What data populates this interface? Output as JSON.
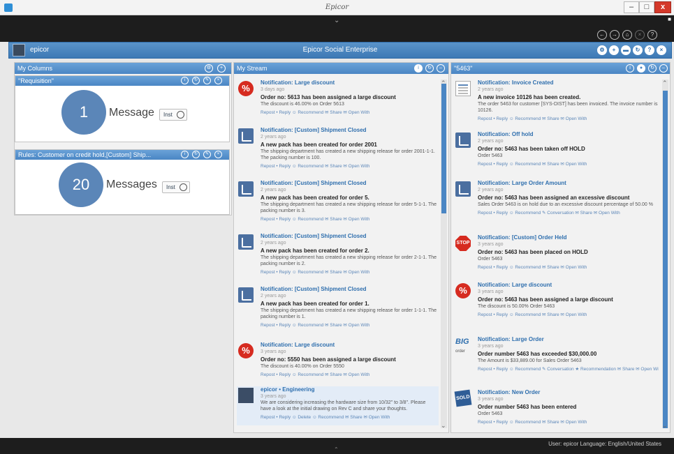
{
  "window": {
    "title": "Epicor",
    "min": "–",
    "max": "□",
    "close": "x",
    "chevron": "⌄"
  },
  "nav_buttons": [
    "←",
    "→",
    "⌂",
    "×",
    "?"
  ],
  "header": {
    "user": "epicor",
    "title": "Epicor Social Enterprise",
    "icons": [
      "gear-icon",
      "plus-icon",
      "chat-icon",
      "refresh-icon",
      "help-icon",
      "close-icon"
    ]
  },
  "left": {
    "title": "My Columns",
    "cards": [
      {
        "title": "\"Requisition\"",
        "count": "1",
        "label": "Message",
        "install": "Inst"
      },
      {
        "title": "Rules: Customer on credit hold,[Custom] Ship...",
        "count": "20",
        "label": "Messages",
        "install": "Inst"
      }
    ]
  },
  "stream": {
    "title": "My Stream",
    "items": [
      {
        "icon": "discount",
        "title": "Notification: Large discount",
        "time": "3 days ago",
        "headline": "Order no: 5613 has been assigned a large discount",
        "desc": "The discount is 46.00% on Order 5613",
        "actions": "Repost • Reply ☺ Recommend ✉ Share ✉ Open With"
      },
      {
        "icon": "rss",
        "title": "Notification: [Custom] Shipment Closed",
        "time": "2 years ago",
        "headline": "A new pack has been created for order 2001",
        "desc": "The shipping department has created a new shipping release for order 2001-1-1. The packing number is 100.",
        "actions": "Repost • Reply ☺ Recommend ✉ Share ✉ Open With"
      },
      {
        "icon": "rss",
        "title": "Notification: [Custom] Shipment Closed",
        "time": "2 years ago",
        "headline": "A new pack has been created for order 5.",
        "desc": "The shipping department has created a new shipping release for order 5-1-1. The packing number is 3.",
        "actions": "Repost • Reply ☺ Recommend ✉ Share ✉ Open With"
      },
      {
        "icon": "rss",
        "title": "Notification: [Custom] Shipment Closed",
        "time": "2 years ago",
        "headline": "A new pack has been created for order 2.",
        "desc": "The shipping department has created a new shipping release for order 2-1-1. The packing number is 2.",
        "actions": "Repost • Reply ☺ Recommend ✉ Share ✉ Open With"
      },
      {
        "icon": "rss",
        "title": "Notification: [Custom] Shipment Closed",
        "time": "2 years ago",
        "headline": "A new pack has been created for order 1.",
        "desc": "The shipping department has created a new shipping release for order 1-1-1. The packing number is 1.",
        "actions": "Repost • Reply ☺ Recommend ✉ Share ✉ Open With"
      },
      {
        "icon": "discount",
        "title": "Notification: Large discount",
        "time": "3 years ago",
        "headline": "Order no: 5550 has been assigned a large discount",
        "desc": "The discount is 40.00% on Order 5550",
        "actions": "Repost • Reply ☺ Recommend ✉ Share ✉ Open With"
      },
      {
        "icon": "person",
        "title": "epicor • Engineering",
        "time": "3 years ago",
        "headline": "",
        "desc": "We are considering increasing the hardware size from 10/32\" to 3/8\". Please have a look at the initial drawing on Rev C and share your thoughts.",
        "actions": "Repost • Reply ☺ Delete ☺ Recommend ✉ Share ✉ Open With"
      }
    ]
  },
  "right": {
    "title": "\"5463\"",
    "items": [
      {
        "icon": "invoice",
        "title": "Notification: Invoice Created",
        "time": "2 years ago",
        "headline": "A new invoice 10126 has been created.",
        "desc": "The order 5463 for customer [SYS-DIST] has been invoiced. The invoice number is 10126.",
        "actions": "Repost • Reply ☺ Recommend ✉ Share ✉ Open With"
      },
      {
        "icon": "rss",
        "title": "Notification: Off hold",
        "time": "2 years ago",
        "headline": "Order no: 5463 has been taken off HOLD",
        "desc": "Order 5463",
        "actions": "Repost • Reply ☺ Recommend ✉ Share ✉ Open With"
      },
      {
        "icon": "rss",
        "title": "Notification: Large Order Amount",
        "time": "2 years ago",
        "headline": "Order no: 5463 has been assigned an excessive discount",
        "desc": "Sales Order 5463 is on hold due to an excessive discount percentage of 50.00 %",
        "actions": "Repost • Reply ☺ Recommend ✎ Conversation ✉ Share ✉ Open With"
      },
      {
        "icon": "stop",
        "title": "Notification: [Custom] Order Held",
        "time": "3 years ago",
        "headline": "Order no: 5463 has been placed on HOLD",
        "desc": "Order 5463",
        "actions": "Repost • Reply ☺ Recommend ✉ Share ✉ Open With"
      },
      {
        "icon": "discount",
        "title": "Notification: Large discount",
        "time": "3 years ago",
        "headline": "Order no: 5463 has been assigned a large discount",
        "desc": "The discount is 50.00% Order 5463",
        "actions": "Repost • Reply ☺ Recommend ✉ Share ✉ Open With"
      },
      {
        "icon": "big",
        "title": "Notification: Large Order",
        "time": "3 years ago",
        "headline": "Order number 5463 has exceeded $30,000.00",
        "desc": "The Amount is $33,889.00 for Sales Order 5463",
        "actions": "Repost • Reply ☺ Recommend ✎ Conversation ★ Recommendation ✉ Share ✉ Open With"
      },
      {
        "icon": "sold",
        "title": "Notification: New Order",
        "time": "3 years ago",
        "headline": "Order number 5463 has been entered",
        "desc": "Order 5463",
        "actions": "Repost • Reply ☺ Recommend ✉ Share ✉ Open With"
      }
    ]
  },
  "status": {
    "text": "User: epicor   Language: English/United States",
    "up": "⌃"
  },
  "icon_text": {
    "discount": "%",
    "stop": "STOP",
    "big": "BIG",
    "big_sub": "order",
    "sold": "SOLD"
  }
}
